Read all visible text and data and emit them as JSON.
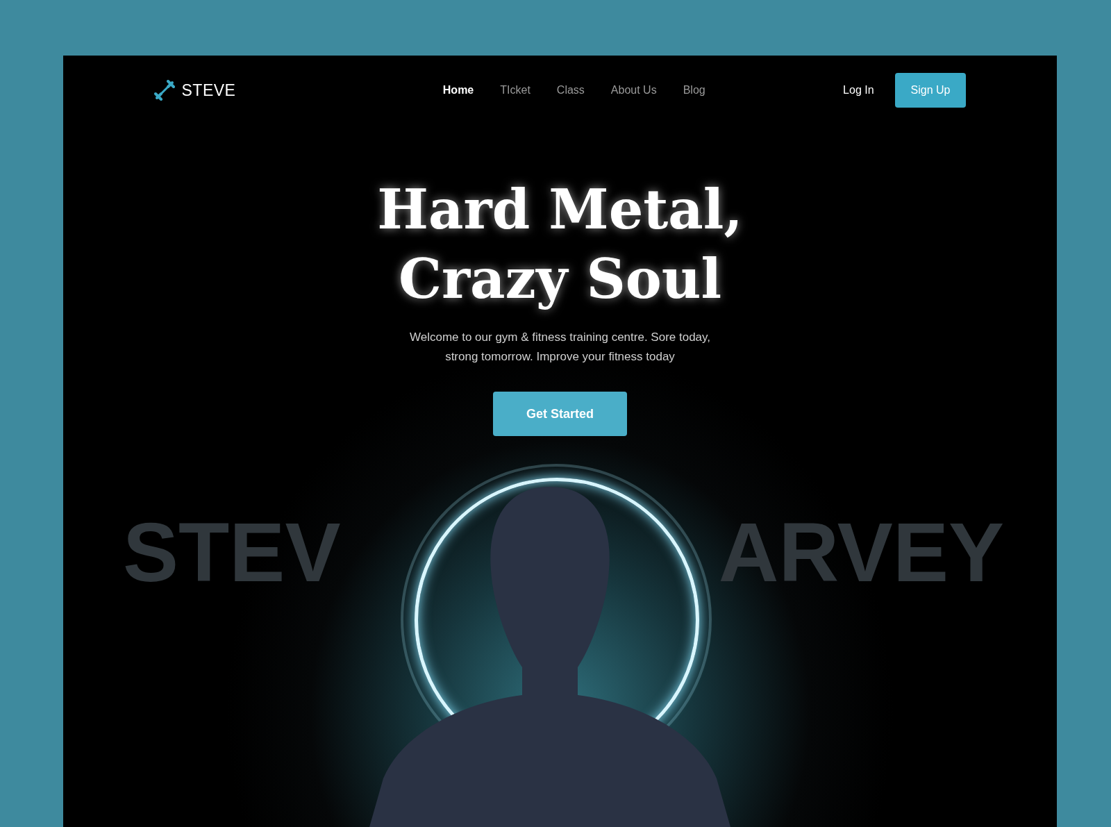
{
  "brand": {
    "name": "STEVE"
  },
  "nav": [
    {
      "label": "Home",
      "selected": true
    },
    {
      "label": "TIcket",
      "selected": false
    },
    {
      "label": "Class",
      "selected": false
    },
    {
      "label": "About Us",
      "selected": false
    },
    {
      "label": "Blog",
      "selected": false
    }
  ],
  "auth": {
    "login": "Log In",
    "signup": "Sign Up"
  },
  "hero": {
    "title_lines": [
      "Hard Metal,",
      "Crazy Soul"
    ],
    "subtitle_lines": [
      "Welcome to our gym & fitness training centre. Sore today,",
      "strong tomorrow. Improve your fitness today"
    ],
    "cta": "Get Started",
    "backdrop_left": "STEV",
    "backdrop_right": "ARVEY"
  }
}
